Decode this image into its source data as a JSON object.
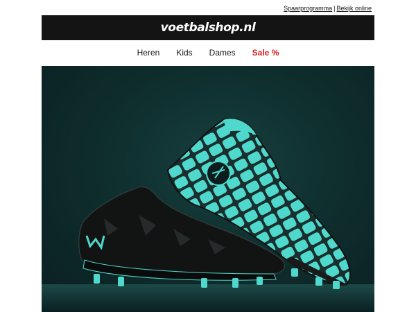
{
  "top_links": {
    "savings": "Spaarprogramma",
    "separator": "|",
    "view_online": "Bekijk online"
  },
  "header": {
    "logo_text": "voetbalshop.nl",
    "background": "#141414"
  },
  "nav": {
    "items": [
      {
        "label": "Heren"
      },
      {
        "label": "Kids"
      },
      {
        "label": "Dames"
      },
      {
        "label": "Sale %",
        "color": "#d81e1e"
      }
    ]
  },
  "hero": {
    "subject": "Under Armour football boots (black and turquoise pair)",
    "accent_color": "#4fd8cc",
    "background_color": "#0f2e2e"
  }
}
